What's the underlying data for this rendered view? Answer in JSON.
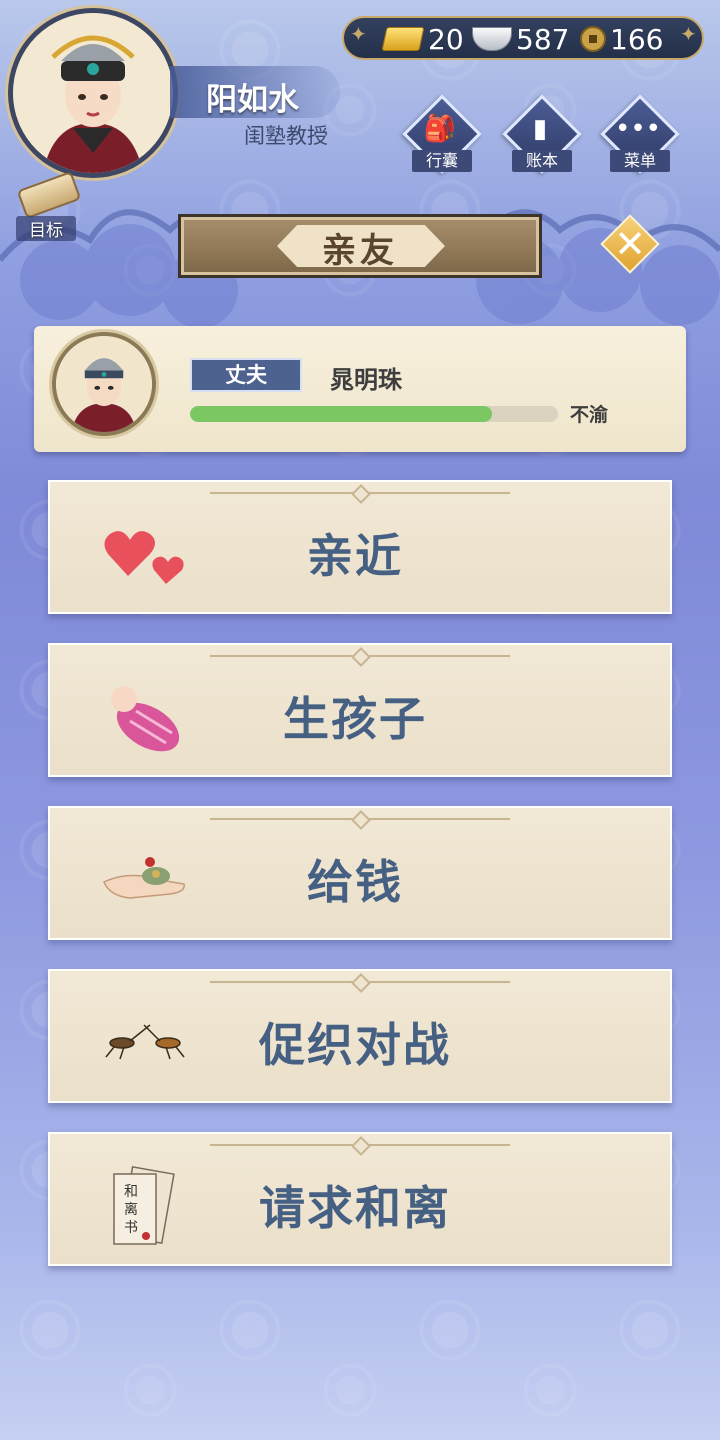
{
  "player": {
    "name": "阳如水",
    "title": "闺塾教授"
  },
  "currency": {
    "gold": "20",
    "silver": "587",
    "coins": "166"
  },
  "menu": {
    "bag_label": "行囊",
    "ledger_label": "账本",
    "menu_label": "菜单",
    "goal_label": "目标"
  },
  "section": {
    "title": "亲友"
  },
  "relative": {
    "role": "丈夫",
    "name": "晁明珠",
    "relationship_level": 0.82,
    "status": "不渝"
  },
  "actions": [
    {
      "label": "亲近",
      "icon": "hearts-icon"
    },
    {
      "label": "生孩子",
      "icon": "baby-icon"
    },
    {
      "label": "给钱",
      "icon": "money-hand-icon"
    },
    {
      "label": "促织对战",
      "icon": "cricket-icon"
    },
    {
      "label": "请求和离",
      "icon": "divorce-letter-icon"
    }
  ],
  "colors": {
    "accent_blue": "#456083",
    "bar_green": "#7bc863",
    "badge_blue": "#4e6290",
    "close_gold": "#e0a330"
  }
}
